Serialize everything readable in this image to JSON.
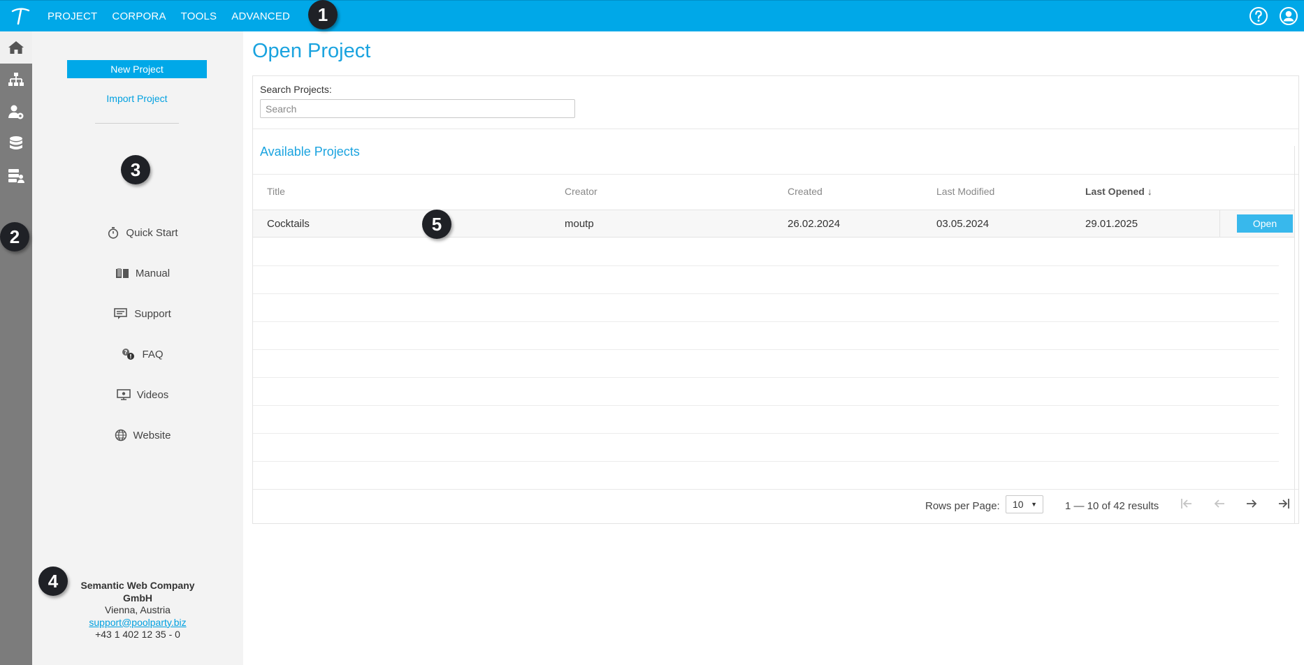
{
  "topbar": {
    "menu": [
      "PROJECT",
      "CORPORA",
      "TOOLS",
      "ADVANCED"
    ],
    "icons": [
      "logo-icon",
      "help-icon",
      "user-icon"
    ],
    "accent_color": "#00a8e8"
  },
  "rail": {
    "icons": [
      "home-icon",
      "hierarchy-icon",
      "user-settings-icon",
      "database-icon",
      "server-user-icon"
    ]
  },
  "sidepanel": {
    "new_project": "New Project",
    "import_project": "Import Project",
    "help_links": [
      "Quick Start",
      "Manual",
      "Support",
      "FAQ",
      "Videos",
      "Website"
    ],
    "company": {
      "name": "Semantic Web Company GmbH",
      "city": "Vienna, Austria",
      "email": "support@poolparty.biz",
      "phone": "+43 1 402 12 35 - 0"
    }
  },
  "main": {
    "title": "Open Project",
    "search_label": "Search Projects:",
    "search_placeholder": "Search",
    "section_title": "Available Projects",
    "columns": [
      "Title",
      "Creator",
      "Created",
      "Last Modified",
      "Last Opened"
    ],
    "sort_indicator": "↓",
    "rows": [
      {
        "title": "Cocktails",
        "creator": "moutp",
        "created": "26.02.2024",
        "modified": "03.05.2024",
        "opened": "29.01.2025",
        "action": "Open"
      }
    ],
    "footer": {
      "rows_per_page_label": "Rows per Page:",
      "rows_per_page": "10",
      "range": "1 — 10 of 42 results"
    }
  },
  "callouts": [
    "1",
    "2",
    "3",
    "4",
    "5"
  ]
}
